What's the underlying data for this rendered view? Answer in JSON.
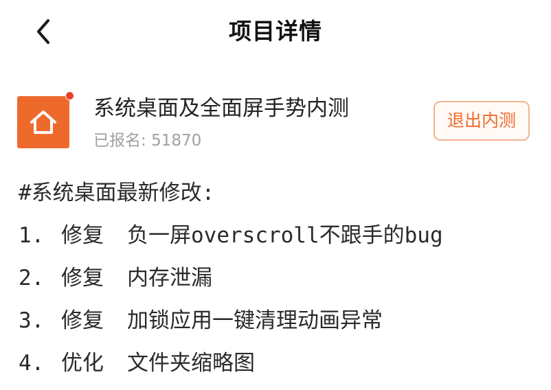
{
  "header": {
    "title": "项目详情",
    "back_icon": "chevron-left-icon"
  },
  "project": {
    "name": "系统桌面及全面屏手势内测",
    "signup_label": "已报名:",
    "signup_count": "51870",
    "icon": "home-icon",
    "icon_color": "#ee6a2c",
    "exit_button_label": "退出内测",
    "accent_color": "#ee6a2c"
  },
  "changelog": {
    "heading": "#系统桌面最新修改:",
    "items": [
      {
        "num": "1.",
        "type": "修复",
        "desc": "负一屏overscroll不跟手的bug"
      },
      {
        "num": "2.",
        "type": "修复",
        "desc": "内存泄漏"
      },
      {
        "num": "3.",
        "type": "修复",
        "desc": "加锁应用一键清理动画异常"
      },
      {
        "num": "4.",
        "type": "优化",
        "desc": "文件夹缩略图"
      }
    ]
  }
}
